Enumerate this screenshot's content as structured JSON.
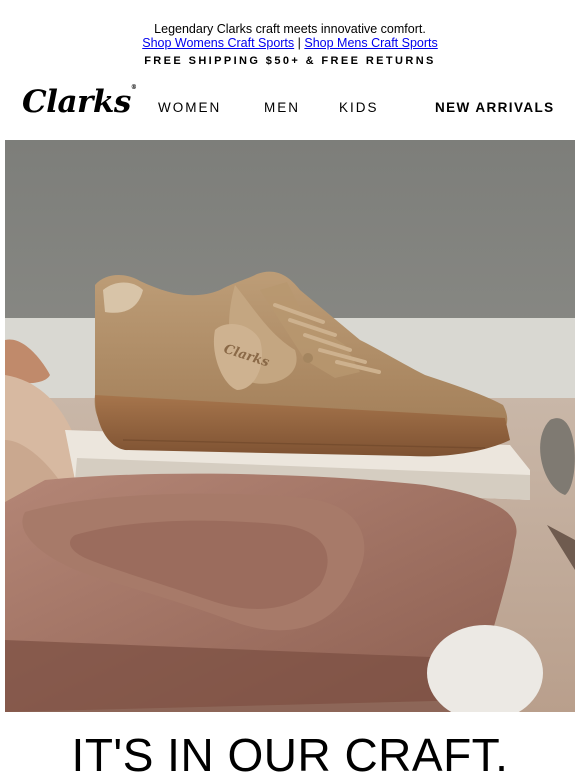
{
  "preheader": {
    "tagline": "Legendary Clarks craft meets innovative comfort.",
    "link_womens": "Shop Womens Craft Sports",
    "separator": " | ",
    "link_mens": "Shop Mens Craft Sports"
  },
  "shipping": "FREE SHIPPING $50+ & FREE RETURNS",
  "brand": {
    "logo_text": "Clarks",
    "logo_mark": "®"
  },
  "nav": {
    "women": "WOMEN",
    "men": "MEN",
    "kids": "KIDS",
    "new_arrivals": "NEW ARRIVALS"
  },
  "hero": {
    "logo_on_shoe": "Clarks"
  },
  "headline": "IT'S IN OUR CRAFT.",
  "colors": {
    "link": "#0000ee",
    "text": "#000000",
    "suede": "#b08e67"
  }
}
